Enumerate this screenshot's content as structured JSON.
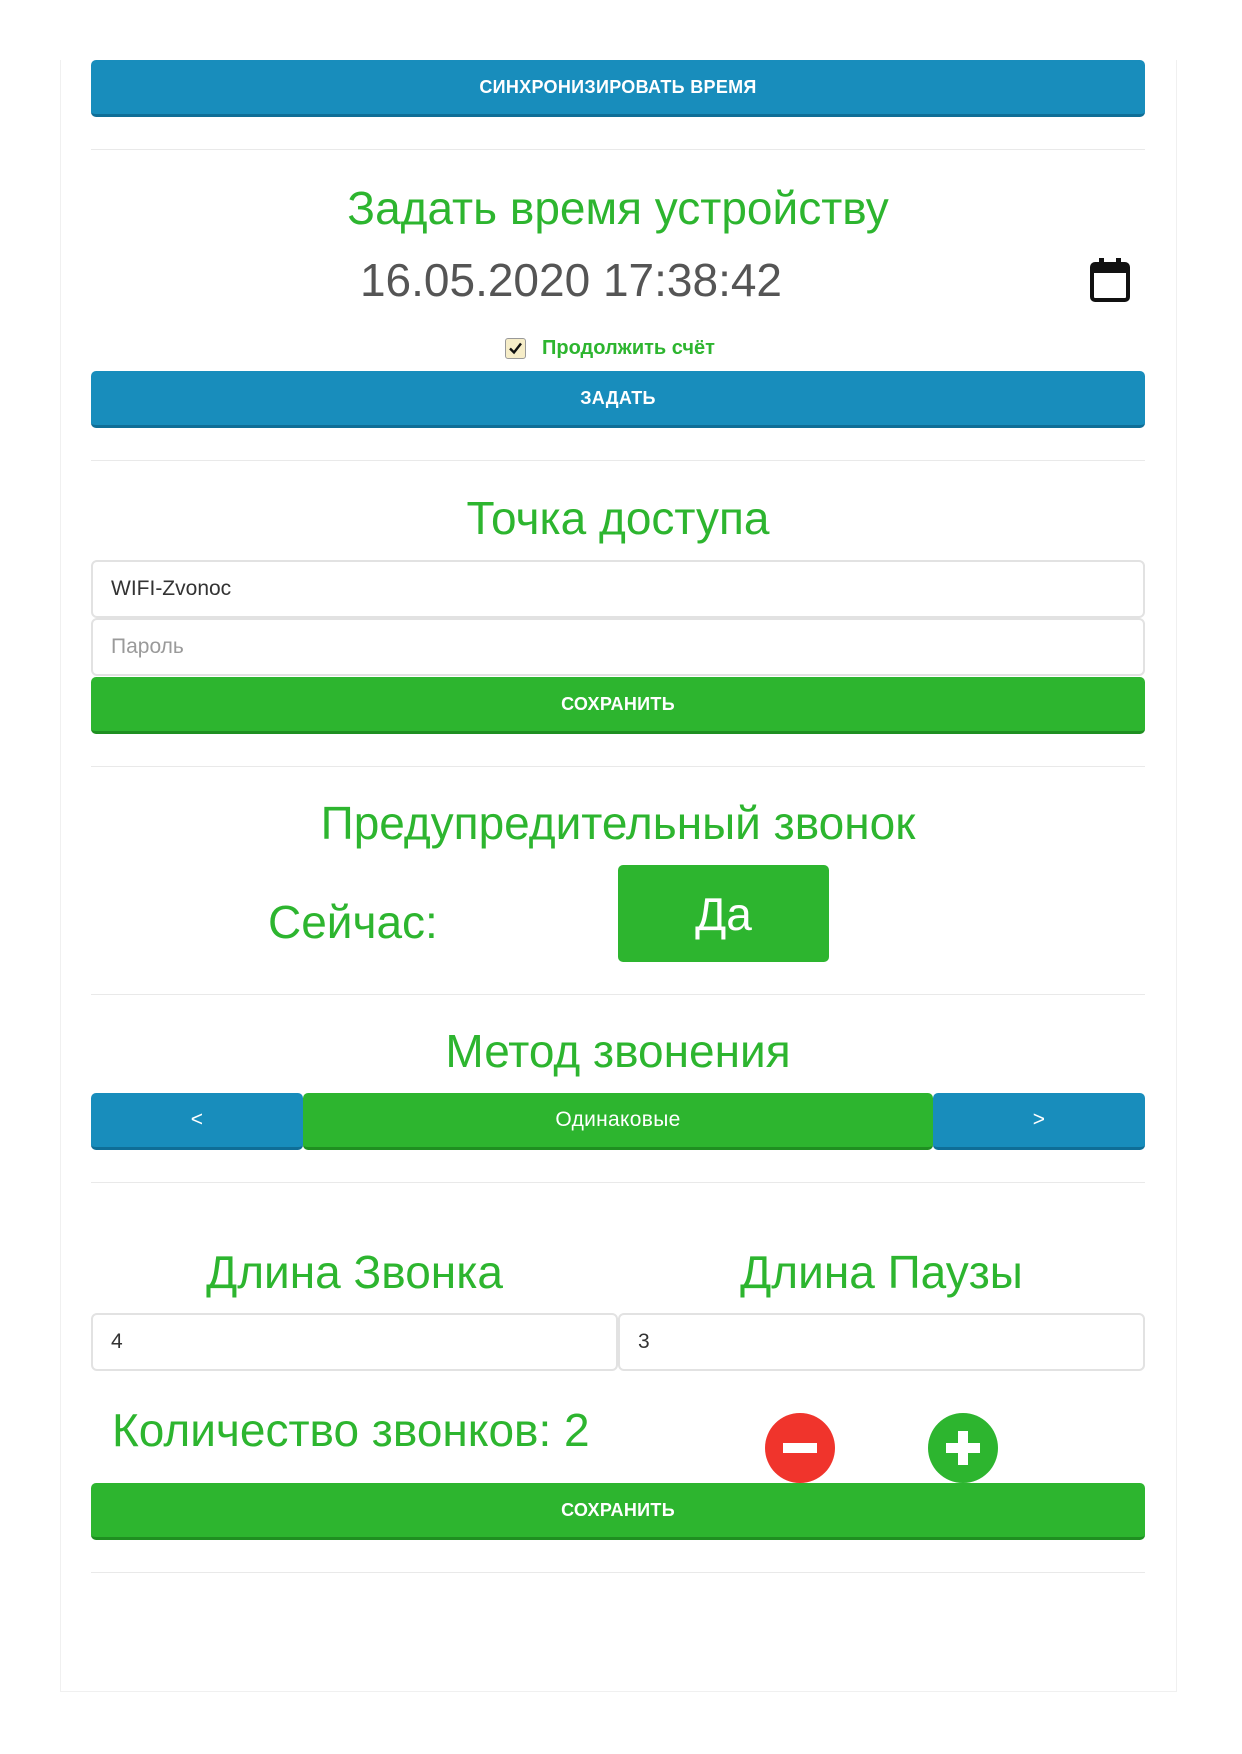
{
  "sync": {
    "button_label": "СИНХРОНИЗИРОВАТЬ ВРЕМЯ"
  },
  "set_time": {
    "title": "Задать время устройству",
    "datetime_value": "16.05.2020 17:38:42",
    "calendar_icon": "calendar-icon",
    "continue_checkbox": {
      "checked": true,
      "label": "Продолжить счёт"
    },
    "button_label": "ЗАДАТЬ"
  },
  "access_point": {
    "title": "Точка доступа",
    "ssid_value": "WIFI-Zvonoc",
    "password_placeholder": "Пароль",
    "save_label": "СОХРАНИТЬ"
  },
  "warning_bell": {
    "title": "Предупредительный звонок",
    "now_label": "Сейчас:",
    "toggle_value": "Да"
  },
  "ring_method": {
    "title": "Метод звонения",
    "prev_label": "<",
    "current_value": "Одинаковые",
    "next_label": ">"
  },
  "durations": {
    "ring_length_title": "Длина Звонка",
    "pause_length_title": "Длина Паузы",
    "ring_length_value": "4",
    "pause_length_value": "3",
    "count_label": "Количество звонков: 2",
    "minus_icon": "minus-circle-icon",
    "plus_icon": "plus-circle-icon",
    "save_label": "СОХРАНИТЬ"
  },
  "colors": {
    "green": "#2db52f",
    "blue": "#188dbc",
    "red": "#f0342c"
  }
}
